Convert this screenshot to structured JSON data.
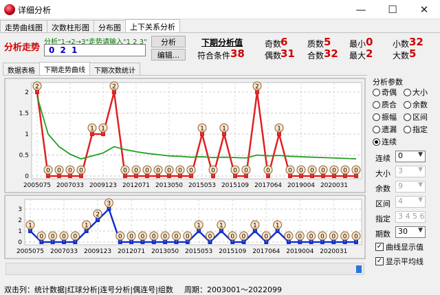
{
  "window": {
    "title": "详细分析",
    "minimize": "—",
    "maximize": "☐",
    "close": "✕"
  },
  "tabs": [
    "走势曲线图",
    "次数柱形图",
    "分布图",
    "上下关系分析"
  ],
  "active_tab": 3,
  "top": {
    "analyze_label": "分析走势",
    "hint": "分析\"1→2→3\"走势请输入\"1 2 3\"",
    "input_value": "0 2 1",
    "analyze_button": "分析",
    "edit_button": "编辑...",
    "next_value_label": "下期分析值",
    "match_label": "符合条件",
    "match_value": "38",
    "stats": [
      {
        "label": "奇数",
        "value": "6"
      },
      {
        "label": "质数",
        "value": "5"
      },
      {
        "label": "最小",
        "value": "0"
      },
      {
        "label": "小数",
        "value": "32"
      },
      {
        "label": "偶数",
        "value": "31"
      },
      {
        "label": "合数",
        "value": "32"
      },
      {
        "label": "最大",
        "value": "2"
      },
      {
        "label": "大数",
        "value": "5"
      }
    ]
  },
  "subtabs": [
    "数据表格",
    "下期走势曲线",
    "下期次数统计"
  ],
  "active_subtab": 1,
  "panel": {
    "title": "分析参数",
    "radios": [
      {
        "label": "奇偶",
        "on": false
      },
      {
        "label": "大小",
        "on": false
      },
      {
        "label": "质合",
        "on": false
      },
      {
        "label": "余数",
        "on": false
      },
      {
        "label": "振幅",
        "on": false
      },
      {
        "label": "区间",
        "on": false
      },
      {
        "label": "遗漏",
        "on": false
      },
      {
        "label": "指定",
        "on": false
      },
      {
        "label": "连续",
        "on": true
      }
    ],
    "params": [
      {
        "label": "连续",
        "value": "0",
        "enabled": true
      },
      {
        "label": "大小",
        "value": "3",
        "enabled": false
      },
      {
        "label": "余数",
        "value": "9",
        "enabled": false
      },
      {
        "label": "区间",
        "value": "4",
        "enabled": false
      },
      {
        "label": "指定",
        "value": "3 4 5 6",
        "enabled": false
      },
      {
        "label": "期数",
        "value": "30",
        "enabled": true
      }
    ],
    "checks": [
      {
        "label": "曲线显示值",
        "checked": true
      },
      {
        "label": "显示平均线",
        "checked": true
      }
    ]
  },
  "statusbar": {
    "left": "双击列：统计数据|红球分析|连号分析|偶连号|组数",
    "right": "周期：2003001～2022099"
  },
  "chart_data": [
    {
      "type": "line",
      "x_tick_labels": [
        "2005075",
        "2007033",
        "2009123",
        "2012071",
        "2013050",
        "2015053",
        "2015109",
        "2017064",
        "2019004",
        "2020031"
      ],
      "ylim": [
        0,
        2
      ],
      "y_ticks": [
        0,
        0.5,
        1,
        1.5,
        2
      ],
      "series": [
        {
          "color": "#e02020",
          "values": [
            2,
            0,
            0,
            0,
            0,
            1,
            1,
            2,
            0,
            0,
            0,
            0,
            0,
            0,
            0,
            1,
            0,
            1,
            0,
            0,
            2,
            0,
            1,
            0,
            0,
            0,
            0,
            0,
            0,
            0
          ]
        },
        {
          "color": "#20a020",
          "values": [
            1.9,
            1.0,
            0.7,
            0.52,
            0.41,
            0.48,
            0.55,
            0.7,
            0.63,
            0.58,
            0.54,
            0.51,
            0.48,
            0.47,
            0.45,
            0.46,
            0.44,
            0.45,
            0.44,
            0.43,
            0.5,
            0.48,
            0.49,
            0.47,
            0.46,
            0.45,
            0.44,
            0.43,
            0.42,
            0.41
          ]
        }
      ]
    },
    {
      "type": "line",
      "x_tick_labels": [
        "2005075",
        "2007033",
        "2009123",
        "2012071",
        "2013050",
        "2015053",
        "2015109",
        "2017064",
        "2019004",
        "2020031"
      ],
      "ylim": [
        0,
        3
      ],
      "y_ticks": [
        0,
        1,
        2,
        3
      ],
      "series": [
        {
          "color": "#1030d0",
          "values": [
            1,
            0,
            0,
            0,
            0,
            1,
            2,
            3,
            0,
            0,
            0,
            0,
            0,
            0,
            0,
            1,
            0,
            1,
            0,
            0,
            1,
            0,
            1,
            0,
            0,
            0,
            0,
            0,
            0,
            0
          ]
        }
      ]
    }
  ]
}
